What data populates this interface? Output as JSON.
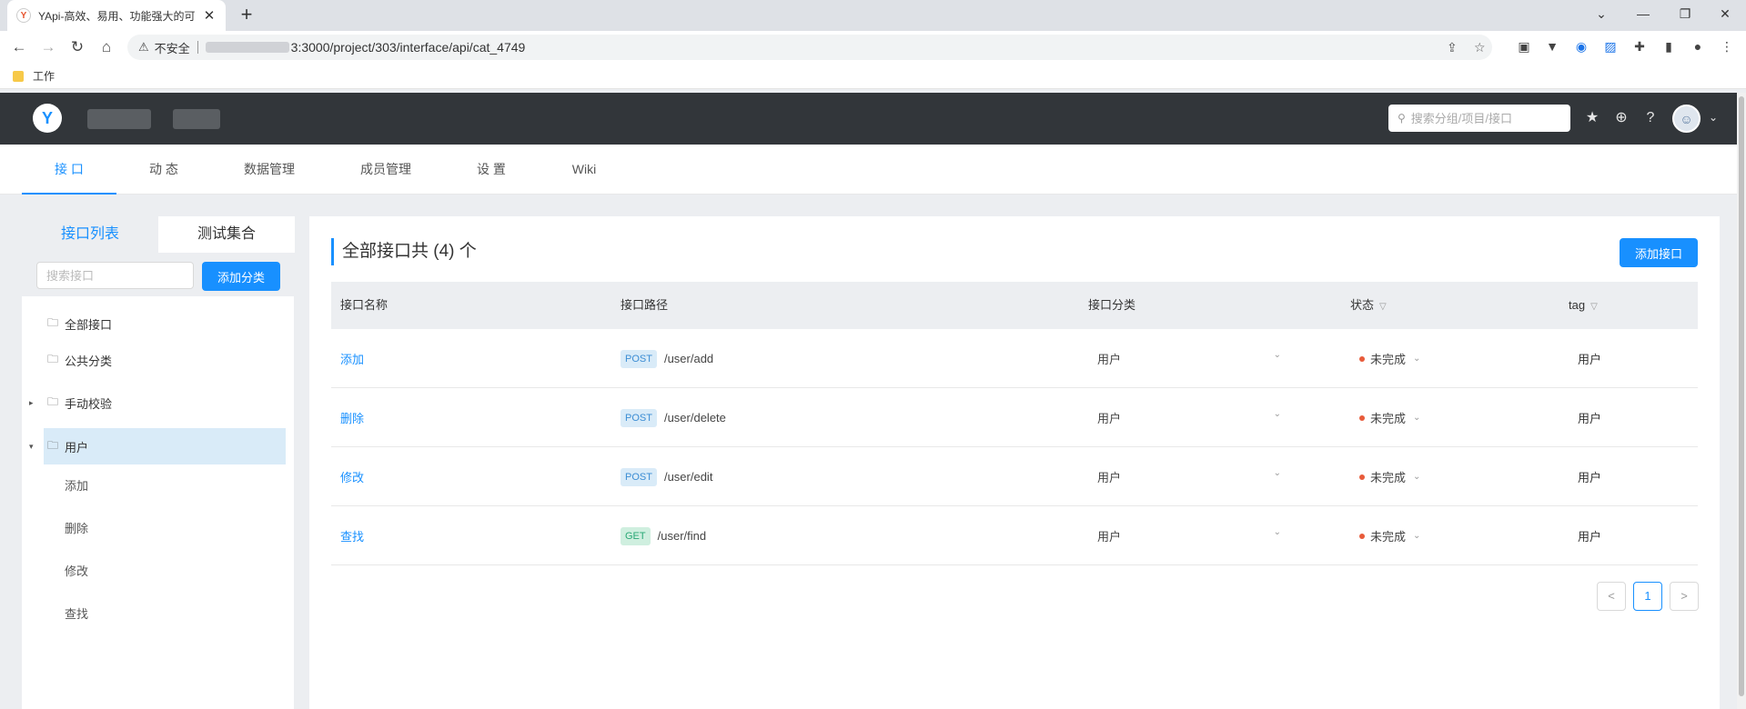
{
  "browser": {
    "tab_title": "YApi-高效、易用、功能强大的可",
    "tab_close": "✕",
    "new_tab": "+",
    "window_controls": [
      "⌄",
      "—",
      "❐",
      "✕"
    ],
    "nav": {
      "back": "←",
      "forward": "→",
      "reload": "↻",
      "home": "⌂"
    },
    "security_warning": "⚠",
    "security_text": "不安全",
    "url": "3:3000/project/303/interface/api/cat_4749",
    "bookmark_folder": "工作"
  },
  "header": {
    "logo_letter": "Y",
    "search_placeholder": "搜索分组/项目/接口",
    "icons": [
      "star-icon",
      "plus-circle-icon",
      "question-icon"
    ]
  },
  "subnav": {
    "items": [
      "接 口",
      "动 态",
      "数据管理",
      "成员管理",
      "设 置",
      "Wiki"
    ],
    "active_index": 0
  },
  "sidebar": {
    "tabs": [
      "接口列表",
      "测试集合"
    ],
    "search_placeholder": "搜索接口",
    "add_category": "添加分类",
    "tree": [
      {
        "label": "全部接口"
      },
      {
        "label": "公共分类"
      },
      {
        "label": "手动校验"
      },
      {
        "label": "用户",
        "selected": true
      }
    ],
    "children": [
      "添加",
      "删除",
      "修改",
      "查找"
    ]
  },
  "main": {
    "title": "全部接口共 (4) 个",
    "add_button": "添加接口",
    "columns": [
      "接口名称",
      "接口路径",
      "接口分类",
      "状态",
      "tag"
    ],
    "rows": [
      {
        "name": "添加",
        "method": "POST",
        "path": "/user/add",
        "category": "用户",
        "status": "未完成",
        "tag": "用户"
      },
      {
        "name": "删除",
        "method": "POST",
        "path": "/user/delete",
        "category": "用户",
        "status": "未完成",
        "tag": "用户"
      },
      {
        "name": "修改",
        "method": "POST",
        "path": "/user/edit",
        "category": "用户",
        "status": "未完成",
        "tag": "用户"
      },
      {
        "name": "查找",
        "method": "GET",
        "path": "/user/find",
        "category": "用户",
        "status": "未完成",
        "tag": "用户"
      }
    ],
    "pagination": {
      "prev": "<",
      "current": "1",
      "next": ">"
    }
  },
  "colors": {
    "accent": "#1890ff",
    "header_bg": "#32363a",
    "status_dot": "#e85b3a"
  }
}
